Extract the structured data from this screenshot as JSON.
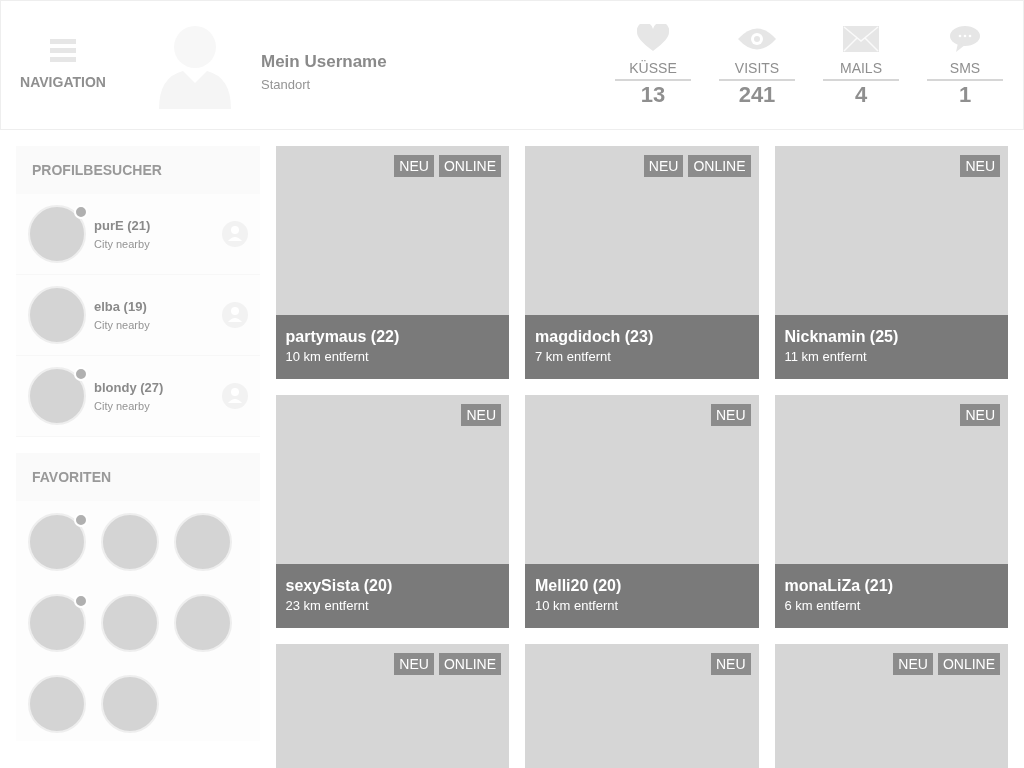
{
  "header": {
    "nav_label": "NAVIGATION",
    "username": "Mein Username",
    "location": "Standort",
    "stats": [
      {
        "kind": "heart",
        "label": "KÜSSE",
        "value": "13"
      },
      {
        "kind": "eye",
        "label": "VISITS",
        "value": "241"
      },
      {
        "kind": "mail",
        "label": "MAILS",
        "value": "4"
      },
      {
        "kind": "chat",
        "label": "SMS",
        "value": "1"
      }
    ]
  },
  "visitors": {
    "title": "PROFILBESUCHER",
    "items": [
      {
        "name": "purE (21)",
        "location": "City nearby",
        "online": true
      },
      {
        "name": "elba (19)",
        "location": "City nearby",
        "online": false
      },
      {
        "name": "blondy (27)",
        "location": "City nearby",
        "online": true
      }
    ]
  },
  "favorites": {
    "title": "FAVORITEN",
    "items": [
      {
        "online": true
      },
      {
        "online": false
      },
      {
        "online": false
      },
      {
        "online": true
      },
      {
        "online": false
      },
      {
        "online": false
      },
      {
        "online": false
      },
      {
        "online": false
      }
    ]
  },
  "profiles": [
    {
      "name": "partymaus (22)",
      "distance": "10 km entfernt",
      "badges": [
        "NEU",
        "ONLINE"
      ]
    },
    {
      "name": "magdidoch (23)",
      "distance": "7 km entfernt",
      "badges": [
        "NEU",
        "ONLINE"
      ]
    },
    {
      "name": "Nicknamin (25)",
      "distance": "11 km entfernt",
      "badges": [
        "NEU"
      ]
    },
    {
      "name": "sexySista (20)",
      "distance": "23 km entfernt",
      "badges": [
        "NEU"
      ]
    },
    {
      "name": "Melli20 (20)",
      "distance": "10 km entfernt",
      "badges": [
        "NEU"
      ]
    },
    {
      "name": "monaLiZa (21)",
      "distance": "6 km entfernt",
      "badges": [
        "NEU"
      ]
    },
    {
      "badges": [
        "NEU",
        "ONLINE"
      ]
    },
    {
      "badges": [
        "NEU"
      ]
    },
    {
      "badges": [
        "NEU",
        "ONLINE"
      ]
    }
  ]
}
